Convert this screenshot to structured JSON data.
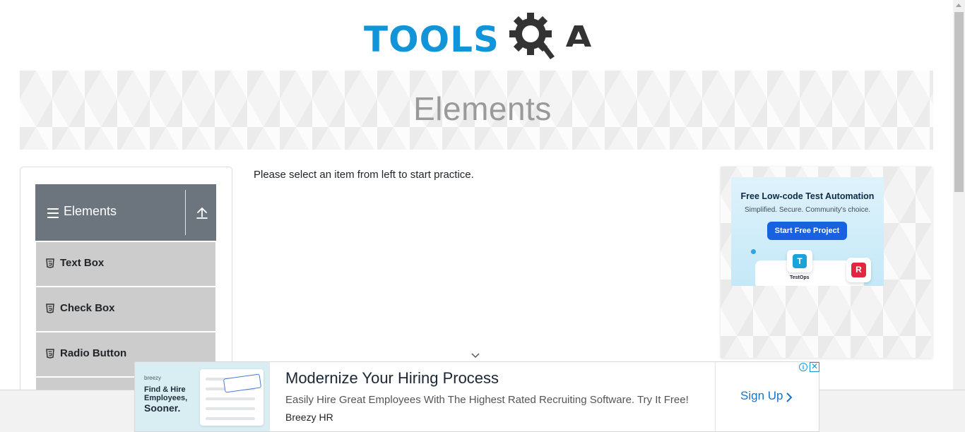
{
  "header": {
    "logo_text": "TOOLSQA",
    "logo_prefix": "TOOLS",
    "logo_suffix": "A",
    "brand_color": "#1295d8"
  },
  "banner": {
    "title": "Elements"
  },
  "sidebar": {
    "group_title": "Elements",
    "group_icon": "menu-icon",
    "collapse_icon": "collapse-up-icon",
    "items": [
      {
        "label": "Text Box",
        "icon": "html5-icon"
      },
      {
        "label": "Check Box",
        "icon": "html5-icon"
      },
      {
        "label": "Radio Button",
        "icon": "html5-icon"
      }
    ]
  },
  "main": {
    "message": "Please select an item from left to start practice."
  },
  "right_ad": {
    "headline": "Free Low-code Test Automation",
    "subline": "Simplified. Secure. Community's choice.",
    "button_label": "Start Free Project",
    "tile_label": "TestOps",
    "tile_letter_1": "T",
    "tile_letter_2": "R"
  },
  "bottom_ad": {
    "image_brand": "breezy",
    "image_tagline_1": "Find & Hire",
    "image_tagline_2": "Employees,",
    "image_tagline_3": "Sooner.",
    "headline": "Modernize Your Hiring Process",
    "description": "Easily Hire Great Employees With The Highest Rated Recruiting Software. Try It Free!",
    "advertiser": "Breezy HR",
    "cta_label": "Sign Up",
    "adchoices_i": "i",
    "adchoices_x": "✕"
  }
}
